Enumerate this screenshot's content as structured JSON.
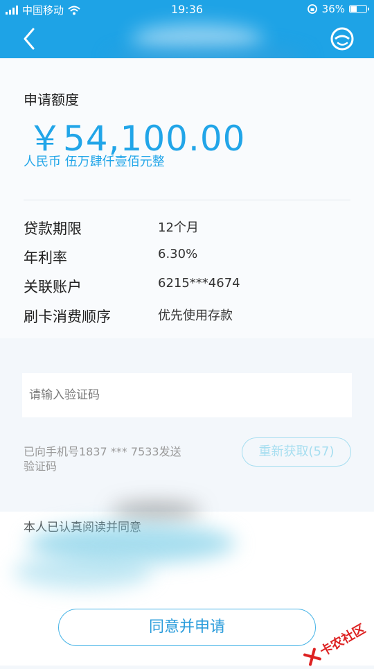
{
  "status_bar": {
    "carrier": "中国移动",
    "time": "19:36",
    "battery_percent": "36%",
    "battery_level": 0.36
  },
  "nav": {
    "back_icon": "chevron-left-icon",
    "service_icon": "customer-service-icon"
  },
  "application": {
    "amount_label": "申请额度",
    "amount": "￥54,100.00",
    "amount_in_words": "人民币 伍万肆仟壹佰元整",
    "details": [
      {
        "label": "贷款期限",
        "value": "12个月"
      },
      {
        "label": "年利率",
        "value": "6.30%"
      },
      {
        "label": "关联账户",
        "value": "6215***4674"
      },
      {
        "label": "刷卡消费顺序",
        "value": "优先使用存款"
      }
    ]
  },
  "verification": {
    "placeholder": "请输入验证码",
    "sms_notice": "已向手机号1837 *** 7533发送验证码",
    "resend_label": "重新获取(57)"
  },
  "agreement": {
    "text": "本人已认真阅读并同意"
  },
  "apply_button": "同意并申请",
  "watermark": {
    "text": "卡农社区",
    "logo_icon": "knot-logo-icon"
  },
  "colors": {
    "primary": "#1ea3e6",
    "amount_blue": "#21a5e8",
    "button_border": "#45b3e6"
  }
}
